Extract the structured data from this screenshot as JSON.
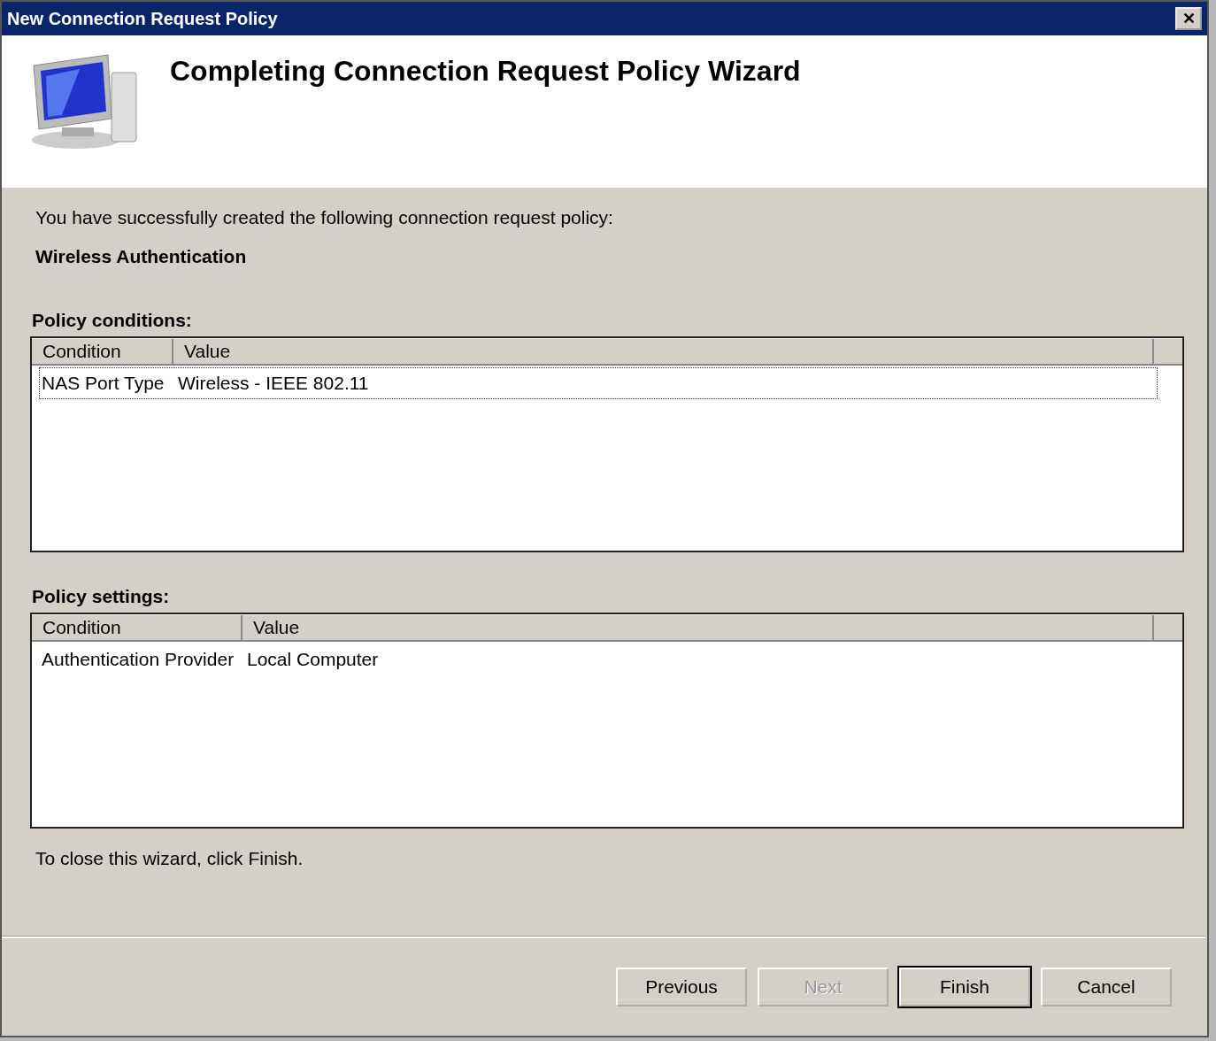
{
  "window": {
    "title": "New Connection Request Policy",
    "close": "✕"
  },
  "heading": "Completing Connection Request Policy Wizard",
  "intro": "You have successfully created the following connection request policy:",
  "policy_name": "Wireless Authentication",
  "conditions": {
    "label": "Policy conditions:",
    "columns": [
      "Condition",
      "Value"
    ],
    "rows": [
      {
        "cells": [
          "NAS Port Type",
          "Wireless - IEEE 802.11"
        ],
        "focused": true
      }
    ]
  },
  "settings": {
    "label": "Policy settings:",
    "columns": [
      "Condition",
      "Value"
    ],
    "rows": [
      {
        "cells": [
          "Authentication Provider",
          "Local Computer"
        ],
        "focused": false
      }
    ]
  },
  "closing_text": "To close this wizard, click Finish.",
  "buttons": [
    {
      "label": "Previous",
      "disabled": false,
      "default": false
    },
    {
      "label": "Next",
      "disabled": true,
      "default": false
    },
    {
      "label": "Finish",
      "disabled": false,
      "default": true
    },
    {
      "label": "Cancel",
      "disabled": false,
      "default": false
    }
  ]
}
